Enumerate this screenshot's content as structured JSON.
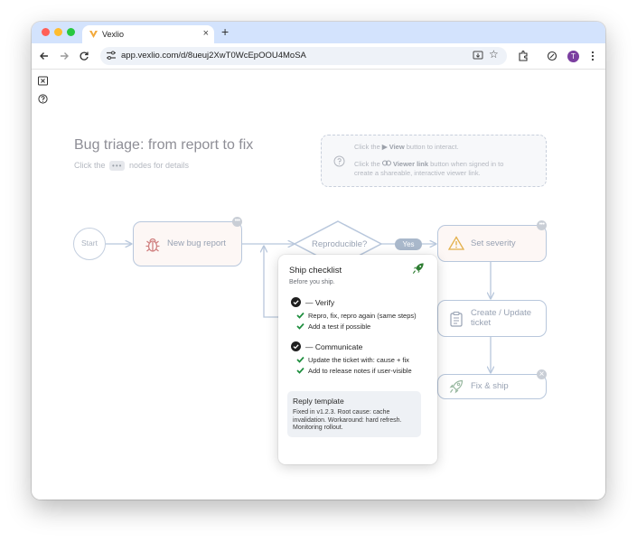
{
  "browser": {
    "tab_title": "Vexlio",
    "tab_close": "×",
    "new_tab": "+",
    "url": "app.vexlio.com/d/8ueuj2XwT0WcEpOOU4MoSA",
    "avatar_letter": "T"
  },
  "diagram": {
    "title": "Bug triage: from report to fix",
    "subtitle_before": "Click the",
    "subtitle_dots": "•••",
    "subtitle_after": "nodes for details"
  },
  "info": {
    "line1_pre": "Click the",
    "line1_bold": "▶ View",
    "line1_post": "button to interact.",
    "line2_pre": "Click the",
    "line2_bold": "Viewer link",
    "line2_post": "button when signed in to",
    "line3": "create a shareable, interactive viewer link."
  },
  "nodes": {
    "start": "Start",
    "new_bug_report": "New bug report",
    "reproducible": "Reproducible?",
    "yes": "Yes",
    "set_severity": "Set severity",
    "create_update_line1": "Create / Update",
    "create_update_line2": "ticket",
    "fix_ship": "Fix & ship",
    "more_dots": "•••",
    "close_x": "×"
  },
  "popover": {
    "title": "Ship checklist",
    "subtitle": "Before you ship.",
    "sections": [
      {
        "heading": "— Verify",
        "items": [
          "Repro, fix, repro again (same steps)",
          "Add a test if possible"
        ]
      },
      {
        "heading": "— Communicate",
        "items": [
          "Update the ticket with: cause + fix",
          "Add to release notes if user-visible"
        ]
      }
    ],
    "reply_title": "Reply template",
    "reply_body": "Fixed in v1.2.3. Root cause: cache invalidation. Workaround: hard refresh. Monitoring rollout."
  },
  "colors": {
    "node_border": "#b8c7dc",
    "check_green": "#1e8e3e",
    "rocket_green": "#2e7d32"
  }
}
